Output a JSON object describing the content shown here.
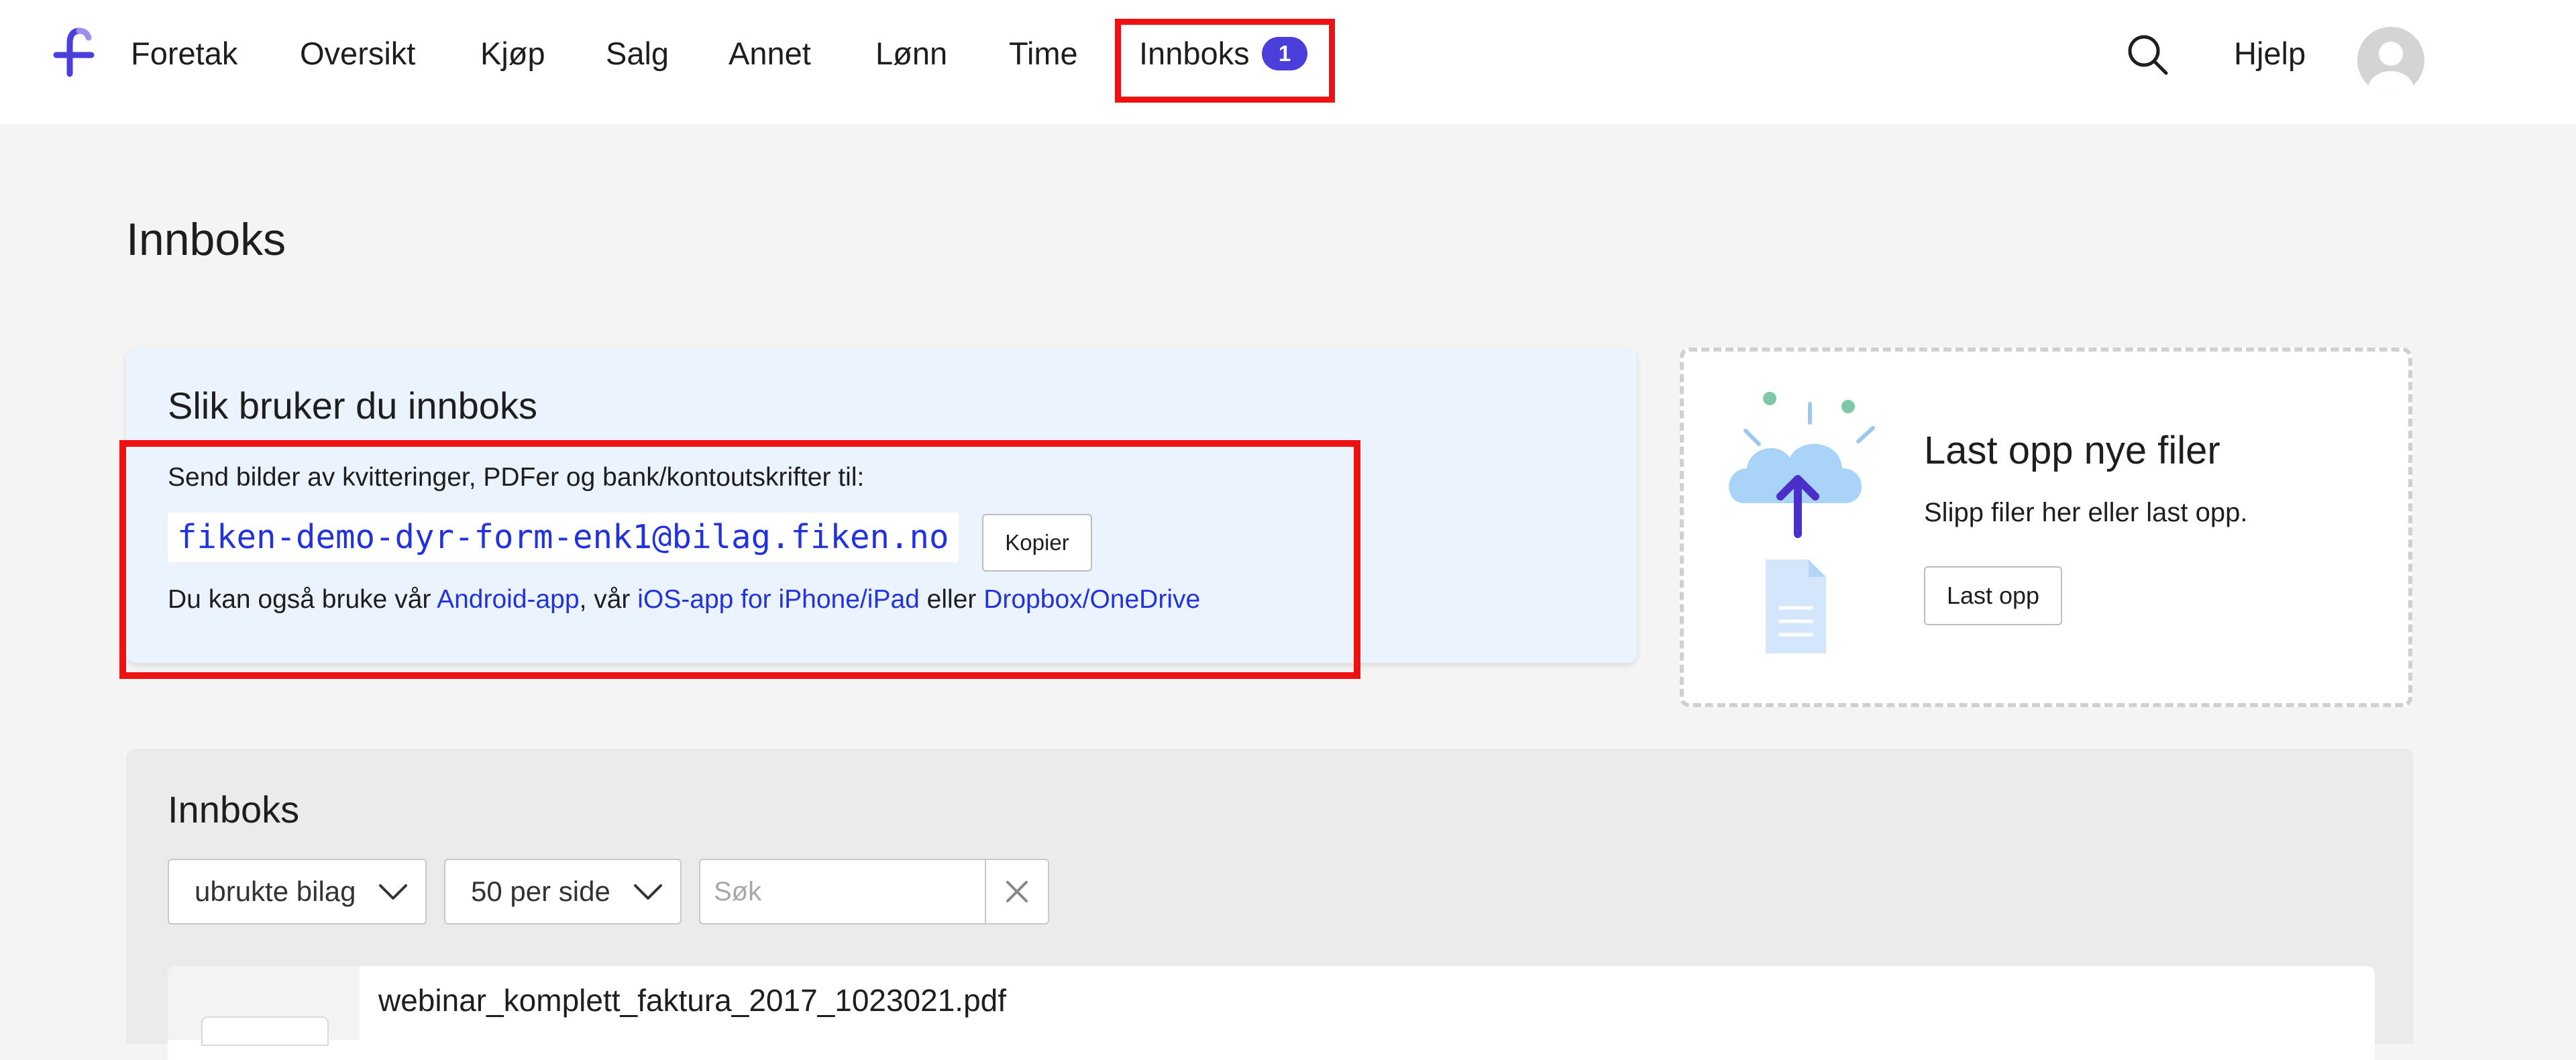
{
  "nav": {
    "items": [
      "Foretak",
      "Oversikt",
      "Kjøp",
      "Salg",
      "Annet",
      "Lønn",
      "Time",
      "Innboks"
    ],
    "inbox_badge": "1",
    "help": "Hjelp"
  },
  "page": {
    "title": "Innboks"
  },
  "howto": {
    "title": "Slik bruker du innboks",
    "send_text": "Send bilder av kvitteringer, PDFer og bank/kontoutskrifter til:",
    "email": "fiken-demo-dyr-form-enk1@bilag.fiken.no",
    "copy_label": "Kopier",
    "also_prefix": "Du kan også bruke vår ",
    "android_link": "Android-app",
    "also_mid": ", vår ",
    "ios_link": "iOS-app for iPhone/iPad",
    "also_or": " eller ",
    "dropbox_link": "Dropbox/OneDrive"
  },
  "upload": {
    "title": "Last opp nye filer",
    "subtitle": "Slipp filer her eller last opp.",
    "button": "Last opp"
  },
  "inbox": {
    "title": "Innboks",
    "filter_value": "ubrukte bilag",
    "per_page_value": "50 per side",
    "search_placeholder": "Søk",
    "rows": [
      {
        "file_name": "webinar_komplett_faktura_2017_1023021.pdf",
        "meta": ""
      }
    ]
  },
  "colors": {
    "brand": "#4b3fdc",
    "link": "#2233dd",
    "highlight": "#ee1111",
    "howto_bg": "#eaf3fe"
  }
}
